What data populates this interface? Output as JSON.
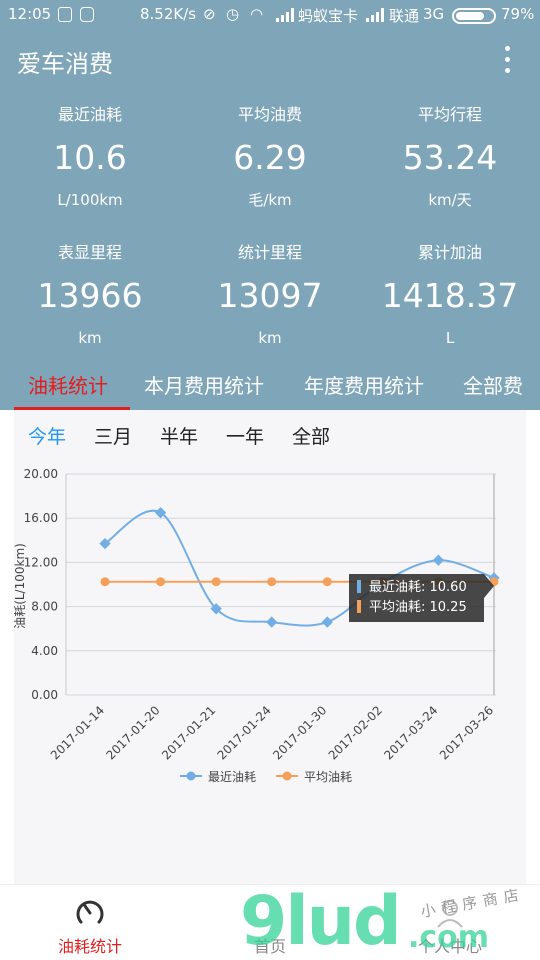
{
  "status_bar": {
    "time": "12:05",
    "speed": "8.52K/s",
    "carrier1": "蚂蚁宝卡",
    "carrier2": "联通",
    "network": "3G",
    "battery_text": "79%",
    "battery_level": 0.79
  },
  "app_bar": {
    "title": "爱车消费"
  },
  "stats": [
    {
      "label": "最近油耗",
      "value": "10.6",
      "unit": "L/100km"
    },
    {
      "label": "平均油费",
      "value": "6.29",
      "unit": "毛/km"
    },
    {
      "label": "平均行程",
      "value": "53.24",
      "unit": "km/天"
    },
    {
      "label": "表显里程",
      "value": "13966",
      "unit": "km"
    },
    {
      "label": "统计里程",
      "value": "13097",
      "unit": "km"
    },
    {
      "label": "累计加油",
      "value": "1418.37",
      "unit": "L"
    }
  ],
  "tabs": [
    {
      "label": "油耗统计",
      "active": true
    },
    {
      "label": "本月费用统计",
      "active": false
    },
    {
      "label": "年度费用统计",
      "active": false
    },
    {
      "label": "全部费",
      "active": false
    }
  ],
  "ranges": [
    {
      "label": "今年",
      "active": true
    },
    {
      "label": "三月",
      "active": false
    },
    {
      "label": "半年",
      "active": false
    },
    {
      "label": "一年",
      "active": false
    },
    {
      "label": "全部",
      "active": false
    }
  ],
  "chart_data": {
    "type": "line",
    "categories": [
      "2017-01-14",
      "2017-01-20",
      "2017-01-21",
      "2017-01-24",
      "2017-01-30",
      "2017-02-02",
      "2017-03-24",
      "2017-03-26"
    ],
    "series": [
      {
        "name": "最近油耗",
        "values": [
          13.7,
          16.5,
          7.8,
          6.6,
          6.6,
          10.2,
          12.2,
          10.6
        ],
        "color": "#72aee6"
      },
      {
        "name": "平均油耗",
        "values": [
          10.25,
          10.25,
          10.25,
          10.25,
          10.25,
          10.25,
          10.25,
          10.25
        ],
        "color": "#f5a05a"
      }
    ],
    "ylabel": "油耗(L/100km)",
    "ylim": [
      0,
      20
    ],
    "yticks": [
      "0.00",
      "4.00",
      "8.00",
      "12.00",
      "16.00",
      "20.00"
    ],
    "grid": true,
    "legend": "bottom",
    "tooltip": {
      "index": 7,
      "lines": [
        "最近油耗: 10.60",
        "平均油耗: 10.25"
      ]
    }
  },
  "bottom_nav": [
    {
      "label": "油耗统计",
      "icon": "gauge-icon",
      "active": true
    },
    {
      "label": "首页",
      "icon": "home-icon",
      "active": false
    },
    {
      "label": "个人中心",
      "icon": "user-icon",
      "active": false
    }
  ],
  "watermark": {
    "logo": "9lud",
    "suffix": ".com",
    "tagline": "小程序商店"
  },
  "colors": {
    "header_bg": "#7fa5b8",
    "accent_red": "#e02020",
    "accent_blue": "#2196f3",
    "series_blue": "#72aee6",
    "series_orange": "#f5a05a"
  }
}
